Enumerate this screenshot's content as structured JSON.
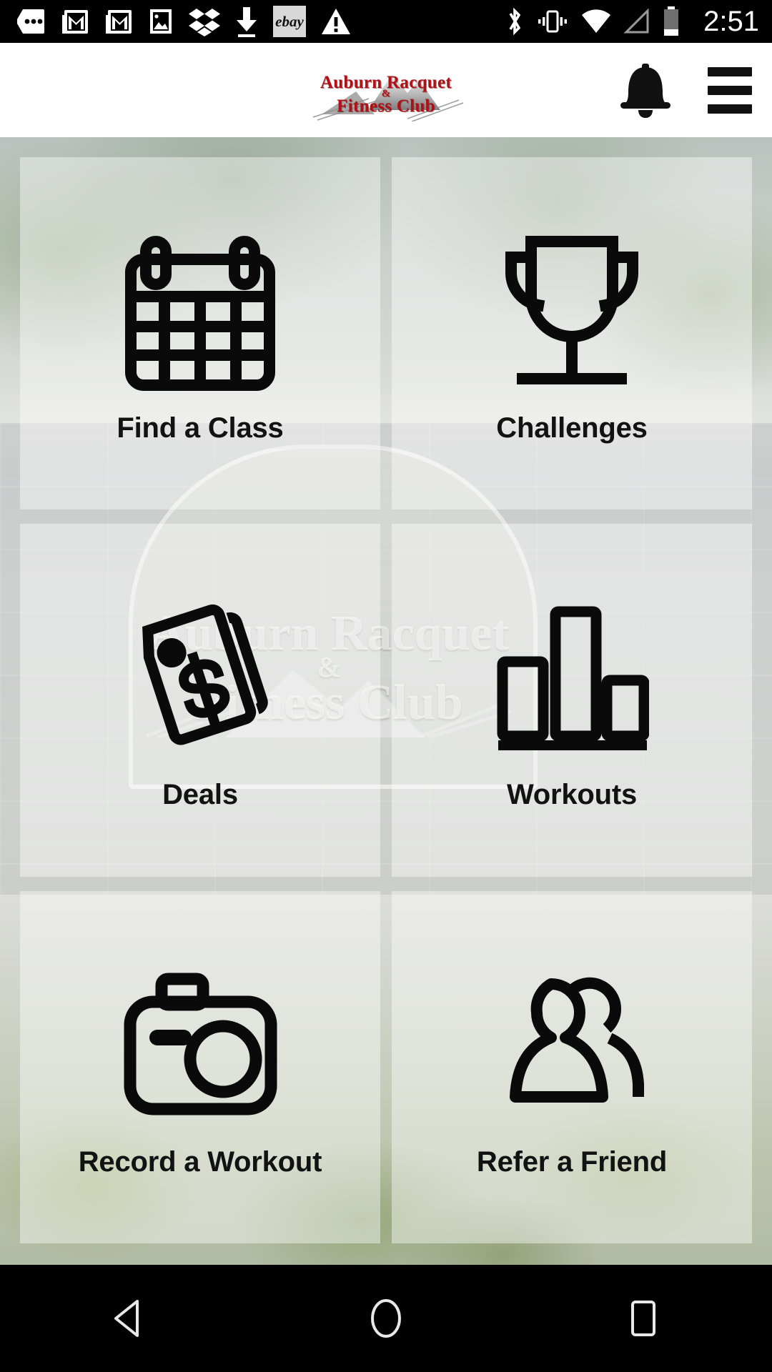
{
  "status_bar": {
    "time": "2:51",
    "left_icons": [
      {
        "name": "messages-dots-icon",
        "label": "messages"
      },
      {
        "name": "gmail-icon",
        "label": "gmail"
      },
      {
        "name": "gmail-icon-2",
        "label": "gmail"
      },
      {
        "name": "photos-image-icon",
        "label": "photo"
      },
      {
        "name": "dropbox-icon",
        "label": "dropbox"
      },
      {
        "name": "download-arrow-icon",
        "label": "download"
      },
      {
        "name": "ebay-icon",
        "label": "ebay"
      },
      {
        "name": "warning-triangle-icon",
        "label": "warning"
      }
    ],
    "right_icons": [
      {
        "name": "bluetooth-icon",
        "label": "bluetooth"
      },
      {
        "name": "vibrate-icon",
        "label": "vibrate"
      },
      {
        "name": "wifi-icon",
        "label": "wifi"
      },
      {
        "name": "cell-signal-icon",
        "label": "signal"
      },
      {
        "name": "battery-icon",
        "label": "battery"
      }
    ]
  },
  "header": {
    "brand_line1": "Auburn Racquet",
    "brand_amp": "&",
    "brand_line2": "Fitness Club",
    "brand_color": "#b01117",
    "notification_icon": "bell-icon",
    "menu_icon": "hamburger-menu-icon"
  },
  "background": {
    "sign_line1": "Auburn Racquet",
    "sign_amp": "&",
    "sign_line2": "Fitness Club"
  },
  "tiles": [
    {
      "id": "find-a-class",
      "label": "Find a Class",
      "icon": "calendar-icon"
    },
    {
      "id": "challenges",
      "label": "Challenges",
      "icon": "trophy-icon"
    },
    {
      "id": "deals",
      "label": "Deals",
      "icon": "price-tag-dollar-icon"
    },
    {
      "id": "workouts",
      "label": "Workouts",
      "icon": "bar-chart-icon"
    },
    {
      "id": "record-a-workout",
      "label": "Record a Workout",
      "icon": "camera-icon"
    },
    {
      "id": "refer-a-friend",
      "label": "Refer a Friend",
      "icon": "two-people-icon"
    }
  ],
  "nav_bar": {
    "back": "back-triangle-icon",
    "home": "home-circle-icon",
    "recents": "recents-square-icon"
  }
}
